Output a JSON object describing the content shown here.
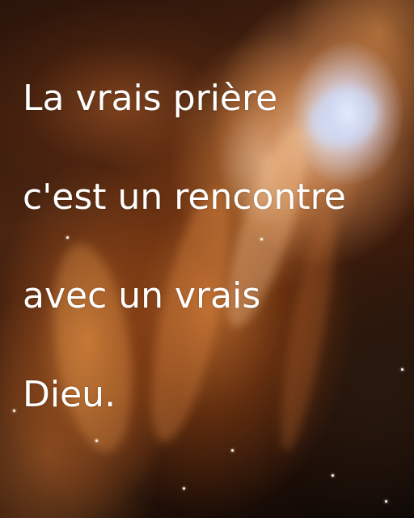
{
  "quote": {
    "line1": "La vrais prière",
    "line2": "c'est un rencontre",
    "line3": "avec un vrais",
    "line4": "Dieu."
  },
  "background": {
    "subject": "nebula",
    "colors": {
      "core": "#ffffff",
      "glow": "#e8a060",
      "gas": "#c8782e",
      "shadow": "#0a0604"
    }
  }
}
